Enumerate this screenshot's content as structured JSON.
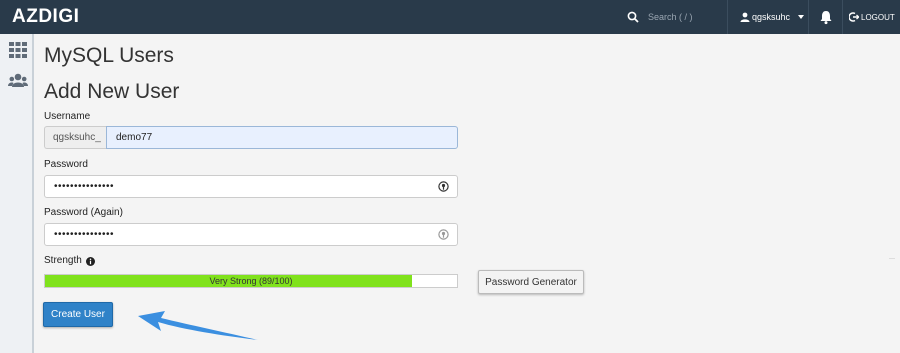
{
  "header": {
    "brand": "AZDIGI",
    "search_placeholder": "Search ( / )",
    "username": "qgsksuhc",
    "logout_label": "LOGOUT"
  },
  "sidebar": {
    "items": [
      {
        "icon": "grid-icon"
      },
      {
        "icon": "users-icon"
      }
    ]
  },
  "page": {
    "title": "MySQL Users",
    "section_title": "Add New User"
  },
  "form": {
    "username_label": "Username",
    "username_prefix": "qgsksuhc_",
    "username_value": "demo77",
    "password_label": "Password",
    "password_value": "•••••••••••••••",
    "password_again_label": "Password (Again)",
    "password_again_value": "•••••••••••••••",
    "strength_label": "Strength",
    "strength_text": "Very Strong (89/100)",
    "strength_fraction": 0.89,
    "password_generator_label": "Password Generator",
    "create_button_label": "Create User"
  },
  "colors": {
    "topbar": "#293a4a",
    "strength_fill": "#80e21c",
    "primary_button": "#2f82c8",
    "arrow": "#3b8fe0"
  }
}
